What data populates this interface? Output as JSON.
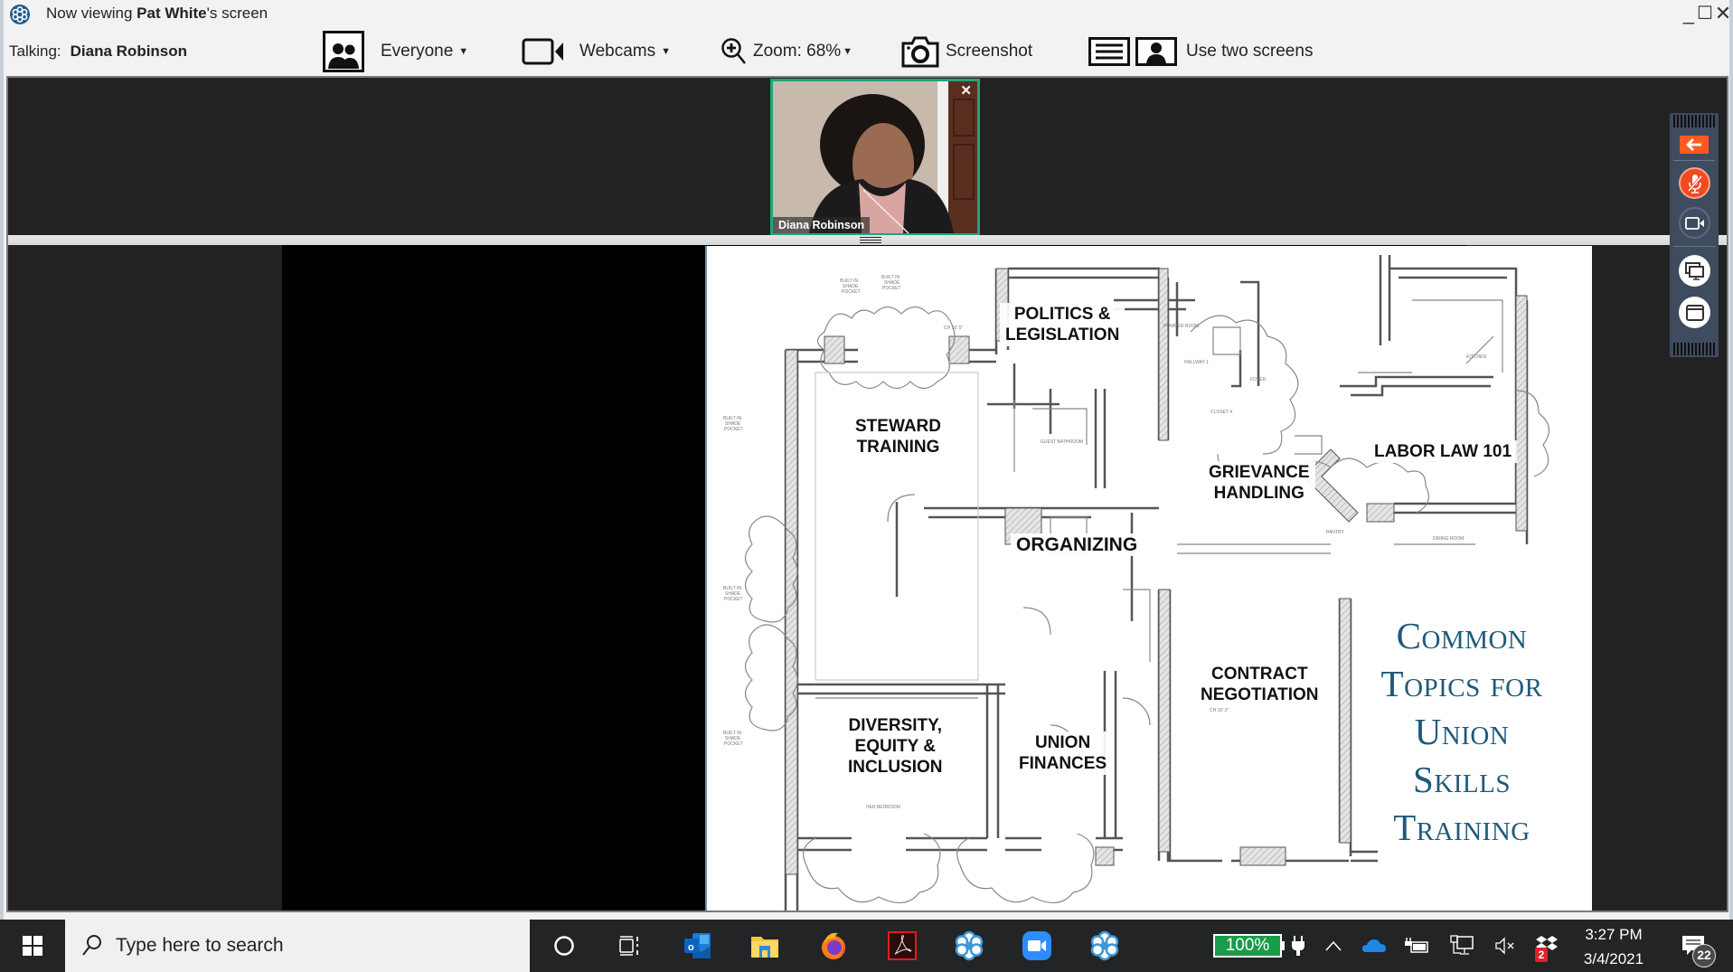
{
  "window": {
    "title_prefix": "Now viewing ",
    "title_name": "Pat White",
    "title_suffix": "'s screen",
    "controls": {
      "minimize": "_",
      "maximize": "☐",
      "close": "✕"
    }
  },
  "toolbar": {
    "talking_label": "Talking:",
    "talking_name": "Diana Robinson",
    "everyone_label": "Everyone",
    "webcams_label": "Webcams",
    "zoom_label": "Zoom: 68%",
    "screenshot_label": "Screenshot",
    "two_screens_label": "Use two screens"
  },
  "webcam": {
    "participant_name": "Diana Robinson",
    "close": "✕",
    "border_color": "#1fa57a"
  },
  "slide": {
    "rooms": [
      {
        "id": "politics",
        "label": "POLITICS &\nLEGISLATION"
      },
      {
        "id": "steward",
        "label": "STEWARD\nTRAINING"
      },
      {
        "id": "organizing",
        "label": "ORGANIZING"
      },
      {
        "id": "grievance",
        "label": "GRIEVANCE\nHANDLING"
      },
      {
        "id": "laborlaw",
        "label": "LABOR LAW 101"
      },
      {
        "id": "contract",
        "label": "CONTRACT\nNEGOTIATION"
      },
      {
        "id": "diversity",
        "label": "DIVERSITY,\nEQUITY &\nINCLUSION"
      },
      {
        "id": "finances",
        "label": "UNION\nFINANCES"
      }
    ],
    "title_lines": [
      "Common",
      "Topics for",
      "Union",
      "Skills",
      "Training"
    ],
    "title_color": "#1e5a7a",
    "plan_notes": [
      "BUILT IN SHADE POCKET",
      "KITCHEN",
      "POWDER ROOM",
      "FOYER",
      "CLOSET 4",
      "GUEST BATHROOM",
      "PANTRY",
      "DINING ROOM",
      "HALLWAY 1"
    ]
  },
  "floating_toolbar": {
    "back_color": "#ff5a1f",
    "mic_muted_color": "#f04a23",
    "buttons": [
      "collapse-arrow",
      "microphone-muted",
      "webcam",
      "share-screens",
      "window"
    ]
  },
  "taskbar": {
    "search_placeholder": "Type here to search",
    "apps": [
      "cortana",
      "task-view",
      "outlook",
      "file-explorer",
      "firefox",
      "acrobat",
      "glance-app",
      "zoom",
      "glance-app-2"
    ],
    "battery_percent": "100%",
    "dropbox_badge": "2",
    "time": "3:27 PM",
    "date": "3/4/2021",
    "notifications_count": "22"
  }
}
